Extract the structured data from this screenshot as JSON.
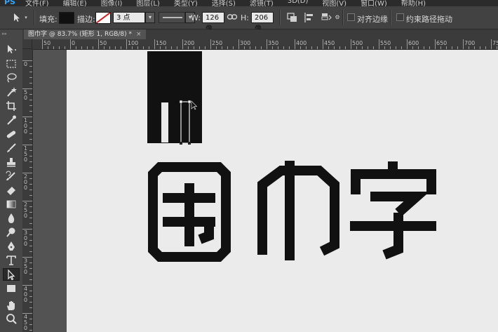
{
  "app": {
    "logo": "PS",
    "menus": [
      "文件(F)",
      "编辑(E)",
      "图像(I)",
      "图层(L)",
      "类型(Y)",
      "选择(S)",
      "滤镜(T)",
      "3D(D)",
      "视图(V)",
      "窗口(W)",
      "帮助(H)"
    ]
  },
  "options": {
    "fill_label": "填充:",
    "stroke_label": "描边:",
    "stroke_width": "3 点",
    "w_label": "W:",
    "w_value": "126 像",
    "h_label": "H:",
    "h_value": "206 像",
    "align_edges_label": "对齐边缘",
    "constrain_path_label": "约束路径拖动",
    "fill_color": "#111111",
    "accent_color": "#cc2222"
  },
  "document": {
    "tab_title": "图巾字 @ 83.7% (矩形 1, RGB/8) *",
    "close_glyph": "×"
  },
  "ruler": {
    "top_labels": [
      "50",
      "0",
      "50",
      "100",
      "150",
      "200",
      "250",
      "300",
      "350",
      "400",
      "450",
      "500",
      "550",
      "600",
      "650",
      "700",
      "750"
    ],
    "left_labels": [
      "0",
      "50",
      "100",
      "150",
      "200",
      "250",
      "300",
      "350",
      "400",
      "450"
    ]
  },
  "toolbar": {
    "tools": [
      "move-tool",
      "marquee-tool",
      "lasso-tool",
      "quick-select-tool",
      "crop-tool",
      "eyedropper-tool",
      "healing-tool",
      "brush-tool",
      "clone-stamp-tool",
      "history-brush-tool",
      "eraser-tool",
      "gradient-tool",
      "blur-tool",
      "dodge-tool",
      "pen-tool",
      "type-tool",
      "path-select-tool",
      "rectangle-tool",
      "hand-tool",
      "zoom-tool"
    ]
  },
  "artwork": {
    "text": "图巾字",
    "color": "#111111"
  }
}
